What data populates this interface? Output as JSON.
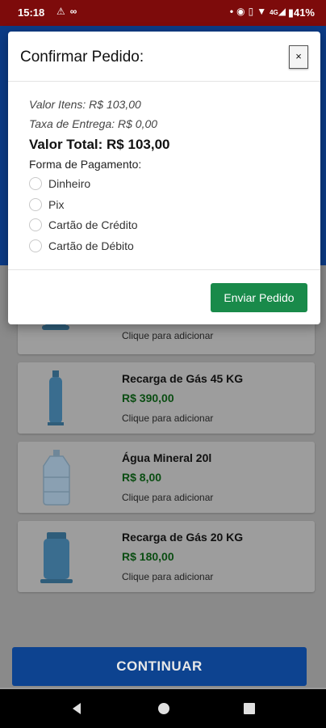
{
  "status_bar": {
    "time": "15:18",
    "left_icons": [
      "warning-icon",
      "link-icon"
    ],
    "right_icons": [
      "dot-icon",
      "location-icon",
      "volte-icon",
      "wifi-icon",
      "signal-icon"
    ],
    "battery": "41%",
    "network": "4G"
  },
  "modal": {
    "title": "Confirmar Pedido:",
    "close_label": "×",
    "valor_itens": "Valor Itens: R$ 103,00",
    "taxa_entrega": "Taxa de Entrega: R$ 0,00",
    "valor_total": "Valor Total: R$ 103,00",
    "payment_label": "Forma de Pagamento:",
    "payment_options": [
      "Dinheiro",
      "Pix",
      "Cartão de Crédito",
      "Cartão de Débito"
    ],
    "send_button": "Enviar Pedido"
  },
  "products": [
    {
      "name": "",
      "price": "",
      "hint": "Clique para adicionar",
      "icon": "gas-cylinder-icon"
    },
    {
      "name": "Recarga de Gás 45 KG",
      "price": "R$ 390,00",
      "hint": "Clique para adicionar",
      "icon": "tall-gas-cylinder-icon"
    },
    {
      "name": "Água Mineral 20l",
      "price": "R$ 8,00",
      "hint": "Clique para adicionar",
      "icon": "water-jug-icon"
    },
    {
      "name": "Recarga de Gás 20 KG",
      "price": "R$ 180,00",
      "hint": "Clique para adicionar",
      "icon": "gas-cylinder-icon"
    }
  ],
  "continue_button": "CONTINUAR",
  "nav": [
    "back-icon",
    "home-icon",
    "recents-icon"
  ],
  "colors": {
    "status_bar": "#7d0b0b",
    "header": "#0b3b86",
    "price": "#0a4d12",
    "send_button": "#198a4a",
    "continue_button": "#0d4390"
  }
}
